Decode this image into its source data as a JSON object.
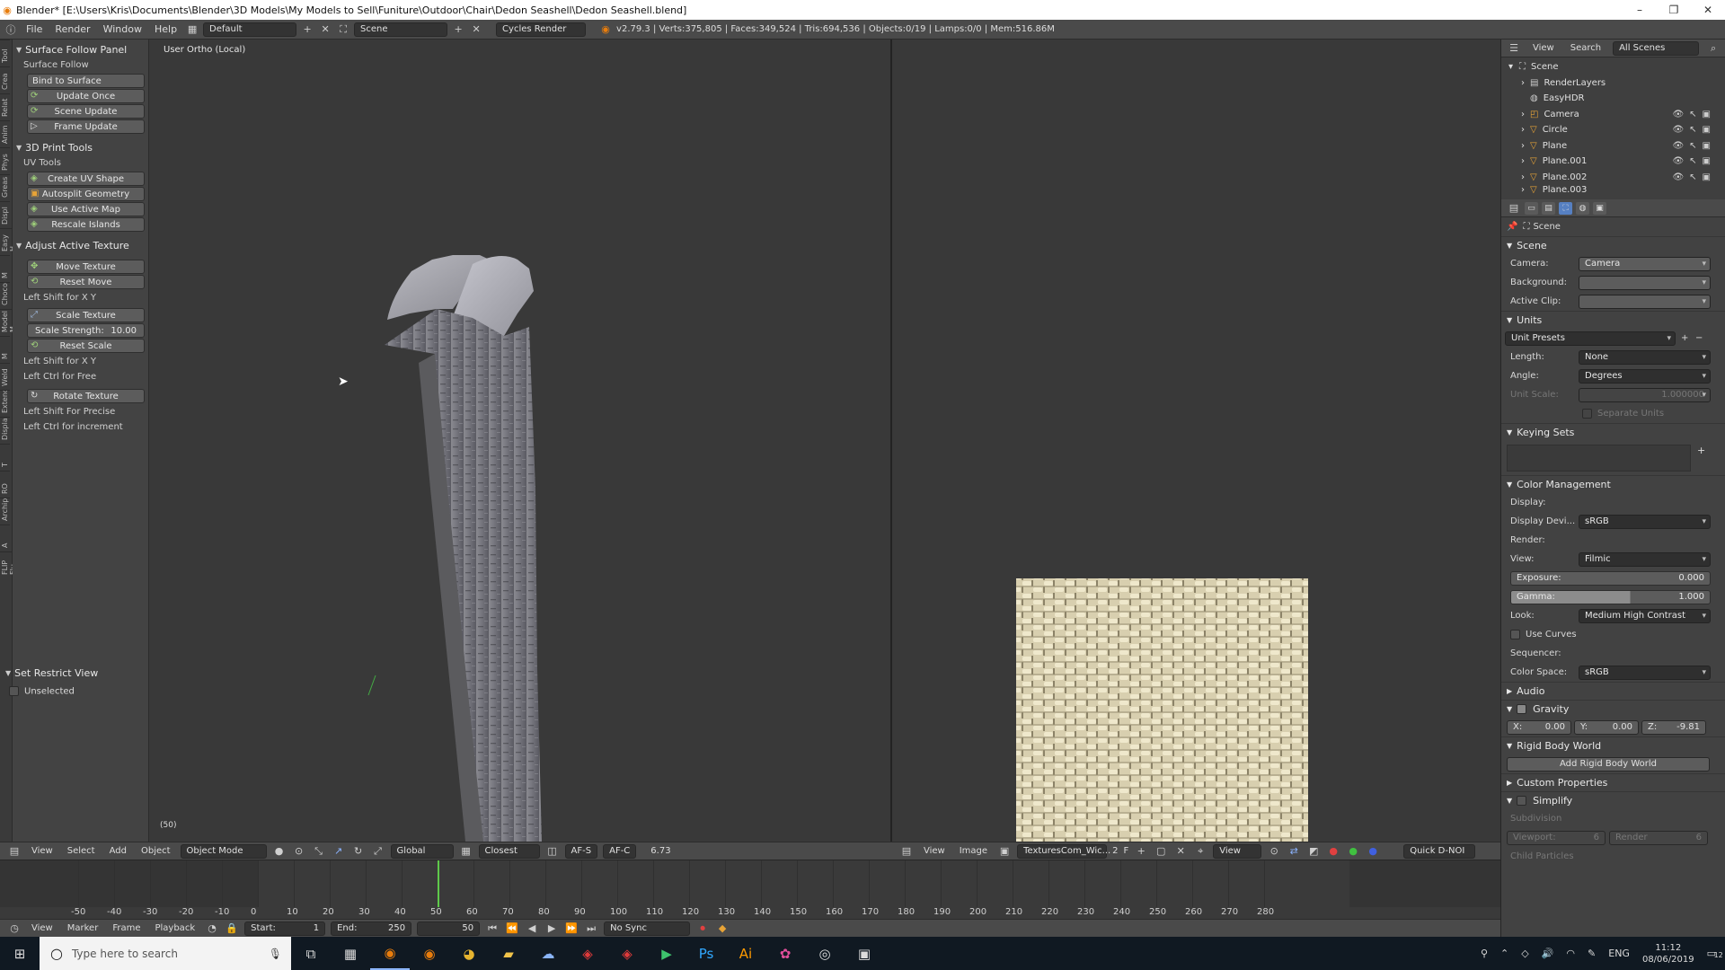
{
  "window": {
    "title": "Blender* [E:\\Users\\Kris\\Documents\\Blender\\3D Models\\My Models to Sell\\Funiture\\Outdoor\\Chair\\Dedon Seashell\\Dedon Seashell.blend]"
  },
  "infobar": {
    "menus": [
      "File",
      "Render",
      "Window",
      "Help"
    ],
    "layout": "Default",
    "scene": "Scene",
    "engine": "Cycles Render",
    "stats": "v2.79.3 | Verts:375,805 | Faces:349,524 | Tris:694,536 | Objects:0/19 | Lamps:0/0 | Mem:516.86M"
  },
  "tooltabs": [
    "Tool",
    "Crea",
    "Relat",
    "Anim",
    "Phys",
    "Greas",
    "Displ",
    "Easy H",
    "M",
    "Chocofur",
    "Model M",
    "M",
    "Weld",
    "Extended",
    "Display",
    "T",
    "RO",
    "Archip",
    "A",
    "FLIP Flu"
  ],
  "toolshelf": {
    "surface_follow": {
      "title": "Surface Follow Panel",
      "label": "Surface Follow",
      "buttons": [
        "Bind to Surface",
        "Update Once",
        "Scene Update",
        "Frame Update"
      ]
    },
    "print3d": {
      "title": "3D Print Tools",
      "label": "UV Tools",
      "buttons": [
        "Create UV Shape",
        "Autosplit Geometry",
        "Use Active Map",
        "Rescale Islands"
      ]
    },
    "adjust": {
      "title": "Adjust Active Texture",
      "move": "Move Texture",
      "reset_move": "Reset Move",
      "hint_move": "Left Shift for X Y",
      "scale": "Scale Texture",
      "scale_label": "Scale Strength:",
      "scale_value": "10.00",
      "reset_scale": "Reset Scale",
      "hint_scale1": "Left Shift for X Y",
      "hint_scale2": "Left Ctrl for Free",
      "rotate": "Rotate Texture",
      "hint_rot1": "Left Shift For Precise",
      "hint_rot2": "Left Ctrl for increment"
    },
    "restrict": {
      "title": "Set Restrict View",
      "unselected": "Unselected"
    }
  },
  "viewport": {
    "label": "User Ortho (Local)",
    "frame": "(50)"
  },
  "hdr3d": {
    "menus": [
      "View",
      "Select",
      "Add",
      "Object"
    ],
    "mode": "Object Mode",
    "orientation": "Global",
    "snap": "Closest",
    "afs": "AF-S",
    "afc": "AF-C",
    "value": "6.73"
  },
  "hdrimg": {
    "menus": [
      "View",
      "Image"
    ],
    "image": "TexturesCom_Wic...",
    "users": "2",
    "fake": "F",
    "view": "View",
    "quick": "Quick D-NOI"
  },
  "timeline": {
    "ticks": [
      "-50",
      "-40",
      "-30",
      "-20",
      "-10",
      "0",
      "10",
      "20",
      "30",
      "40",
      "50",
      "60",
      "70",
      "80",
      "90",
      "100",
      "110",
      "120",
      "130",
      "140",
      "150",
      "160",
      "170",
      "180",
      "190",
      "200",
      "210",
      "220",
      "230",
      "240",
      "250",
      "260",
      "270",
      "280"
    ],
    "current": 50
  },
  "tlhdr": {
    "menus": [
      "View",
      "Marker",
      "Frame",
      "Playback"
    ],
    "start": "Start:",
    "start_v": "1",
    "end": "End:",
    "end_v": "250",
    "frame_v": "50",
    "sync": "No Sync"
  },
  "outliner": {
    "menus": [
      "View",
      "Search"
    ],
    "scenes": "All Scenes",
    "rows": [
      "Scene",
      "RenderLayers",
      "EasyHDR",
      "Camera",
      "Circle",
      "Plane",
      "Plane.001",
      "Plane.002",
      "Plane.003"
    ]
  },
  "props": {
    "crumb": "Scene",
    "scene": {
      "title": "Scene",
      "camera_l": "Camera:",
      "camera_v": "Camera",
      "bg_l": "Background:",
      "clip_l": "Active Clip:"
    },
    "units": {
      "title": "Units",
      "presets": "Unit Presets",
      "length_l": "Length:",
      "length_v": "None",
      "angle_l": "Angle:",
      "angle_v": "Degrees",
      "scale_l": "Unit Scale:",
      "scale_v": "1.000000",
      "sep": "Separate Units"
    },
    "keying": {
      "title": "Keying Sets"
    },
    "color": {
      "title": "Color Management",
      "display": "Display:",
      "dev_l": "Display Devi...",
      "dev_v": "sRGB",
      "render": "Render:",
      "view_l": "View:",
      "view_v": "Filmic",
      "exp_l": "Exposure:",
      "exp_v": "0.000",
      "gam_l": "Gamma:",
      "gam_v": "1.000",
      "look_l": "Look:",
      "look_v": "Medium High Contrast",
      "curves": "Use Curves",
      "seq": "Sequencer:",
      "cs_l": "Color Space:",
      "cs_v": "sRGB"
    },
    "audio": "Audio",
    "gravity": {
      "title": "Gravity",
      "x": "X:",
      "xv": "0.00",
      "y": "Y:",
      "yv": "0.00",
      "z": "Z:",
      "zv": "-9.81"
    },
    "rigid": {
      "title": "Rigid Body World",
      "btn": "Add Rigid Body World"
    },
    "custom": "Custom Properties",
    "simplify": {
      "title": "Simplify",
      "sub": "Subdivision",
      "vp": "Viewport:",
      "vpv": "6",
      "r": "Render",
      "rv": "6",
      "cp": "Child Particles"
    }
  },
  "taskbar": {
    "search": "Type here to search",
    "lang": "ENG",
    "time": "11:12",
    "date": "08/06/2019",
    "notif": "12"
  },
  "colors": {
    "accent": "#5680c2",
    "current_frame": "#5ec94a",
    "header": "#4a4a4a"
  }
}
